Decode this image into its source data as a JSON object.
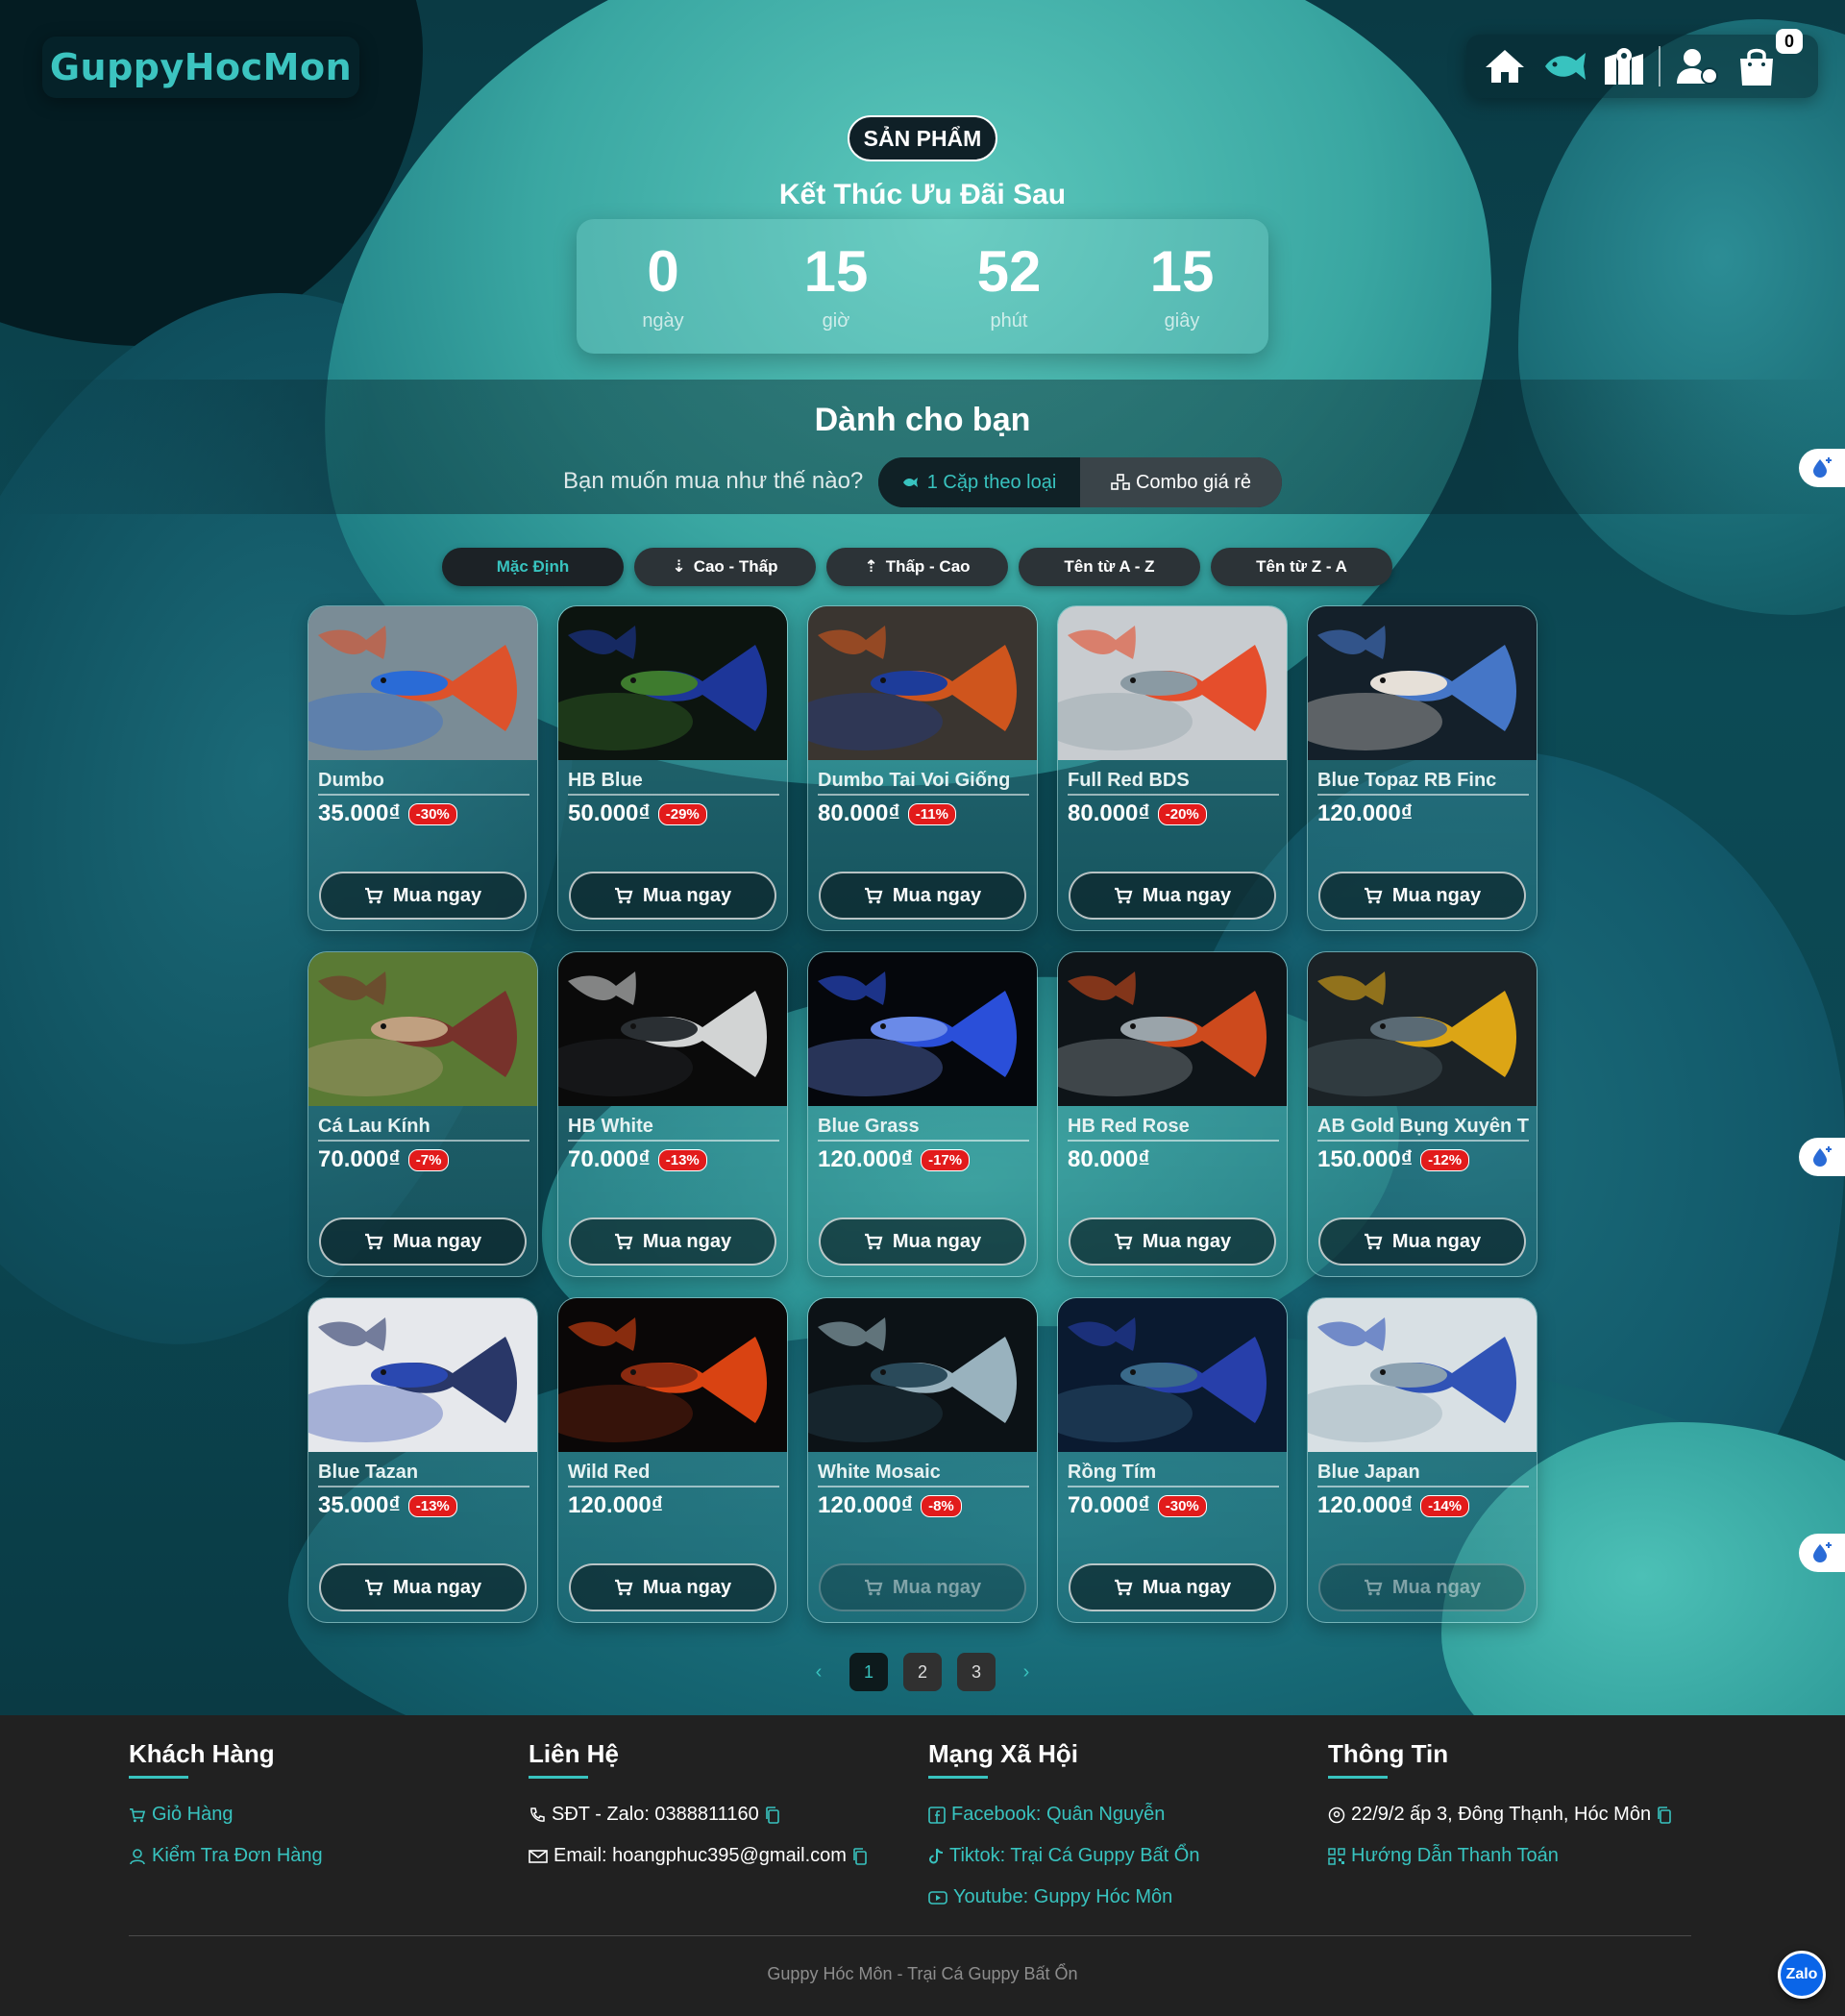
{
  "brand": {
    "logo_text": "GuppyHocMon"
  },
  "nav": {
    "icons": [
      "home-icon",
      "fish-icon",
      "map-icon",
      "user-icon",
      "shopping-bag-icon"
    ],
    "cart_count": "0"
  },
  "section": {
    "pill_title": "SẢN PHẨM",
    "countdown_title": "Kết Thúc Ưu Đãi Sau",
    "countdown": [
      {
        "value": "0",
        "label": "ngày"
      },
      {
        "value": "15",
        "label": "giờ"
      },
      {
        "value": "52",
        "label": "phút"
      },
      {
        "value": "15",
        "label": "giây"
      }
    ]
  },
  "recommend": {
    "title": "Dành cho bạn",
    "question": "Bạn muốn mua như thế nào?",
    "options": [
      "1 Cặp theo loại",
      "Combo giá rẻ"
    ],
    "selected": "1 Cặp theo loại"
  },
  "sort": {
    "options": [
      "Mặc Định",
      "Cao - Thấp",
      "Thấp - Cao",
      "Tên từ A - Z",
      "Tên từ Z - A"
    ],
    "selected": "Mặc Định"
  },
  "buy_label": "Mua ngay",
  "products": [
    {
      "name": "Dumbo",
      "price": "35.000₫",
      "discount": "-30%",
      "palette": [
        "#7a8c96",
        "#e84b1f",
        "#2a6bd6"
      ],
      "dim": false
    },
    {
      "name": "HB Blue",
      "price": "50.000₫",
      "discount": "-29%",
      "palette": [
        "#0c140f",
        "#1f3aa8",
        "#3e7b2e"
      ],
      "dim": false
    },
    {
      "name": "Dumbo Tai Voi Giống",
      "price": "80.000₫",
      "discount": "-11%",
      "palette": [
        "#3a3530",
        "#e0591c",
        "#1d3c9a"
      ],
      "dim": false
    },
    {
      "name": "Full Red BDS",
      "price": "80.000₫",
      "discount": "-20%",
      "palette": [
        "#c8ccd0",
        "#e8401a",
        "#8a9aa3"
      ],
      "dim": false
    },
    {
      "name": "Blue Topaz RB Finc",
      "price": "120.000₫",
      "discount": "",
      "palette": [
        "#14202a",
        "#4a80d8",
        "#e6e0d8"
      ],
      "dim": false
    },
    {
      "name": "Cá Lau Kính",
      "price": "70.000₫",
      "discount": "-7%",
      "palette": [
        "#5a7a34",
        "#7a2a2a",
        "#c0a080"
      ],
      "dim": false
    },
    {
      "name": "HB White",
      "price": "70.000₫",
      "discount": "-13%",
      "palette": [
        "#0a0a0a",
        "#e8eaea",
        "#2a2f33"
      ],
      "dim": false
    },
    {
      "name": "Blue Grass",
      "price": "120.000₫",
      "discount": "-17%",
      "palette": [
        "#05070c",
        "#2f58f0",
        "#6a8ae8"
      ],
      "dim": false
    },
    {
      "name": "HB Red Rose",
      "price": "80.000₫",
      "discount": "",
      "palette": [
        "#0e1418",
        "#e2501e",
        "#9aa4aa"
      ],
      "dim": false
    },
    {
      "name": "AB Gold Bụng Xuyên Tl",
      "price": "150.000₫",
      "discount": "-12%",
      "palette": [
        "#1b2226",
        "#f2b414",
        "#5a6a74"
      ],
      "dim": false
    },
    {
      "name": "Blue Tazan",
      "price": "35.000₫",
      "discount": "-13%",
      "palette": [
        "#e6e8ec",
        "#14235a",
        "#2a48b0"
      ],
      "dim": false
    },
    {
      "name": "Wild Red",
      "price": "120.000₫",
      "discount": "",
      "palette": [
        "#0a0707",
        "#f04a14",
        "#8a2a10"
      ],
      "dim": false
    },
    {
      "name": "White Mosaic",
      "price": "120.000₫",
      "discount": "-8%",
      "palette": [
        "#0c1216",
        "#a8c4d0",
        "#2a4a5a"
      ],
      "dim": true
    },
    {
      "name": "Rồng Tím",
      "price": "70.000₫",
      "discount": "-30%",
      "palette": [
        "#0a1a30",
        "#2a44b8",
        "#3a6a8a"
      ],
      "dim": false
    },
    {
      "name": "Blue Japan",
      "price": "120.000₫",
      "discount": "-14%",
      "palette": [
        "#d8e0e4",
        "#1e44b0",
        "#8aa0b0"
      ],
      "dim": true
    }
  ],
  "pagination": {
    "pages": [
      "1",
      "2",
      "3"
    ],
    "current": "1",
    "prev": "‹",
    "next": "›"
  },
  "footer": {
    "columns": [
      {
        "title": "Khách Hàng",
        "links": [
          {
            "icon": "cart-icon",
            "text": "Giỏ Hàng",
            "color": "cyan"
          },
          {
            "icon": "user-icon",
            "text": "Kiểm Tra Đơn Hàng",
            "color": "cyan"
          }
        ]
      },
      {
        "title": "Liên Hệ",
        "links": [
          {
            "icon": "phone-icon",
            "text": "SĐT - Zalo: 0388811160",
            "color": "white",
            "copy": true
          },
          {
            "icon": "mail-icon",
            "text": "Email: hoangphuc395@gmail.com",
            "color": "white",
            "copy": true
          }
        ]
      },
      {
        "title": "Mạng Xã Hội",
        "links": [
          {
            "icon": "facebook-icon",
            "text": "Facebook: Quân Nguyễn",
            "color": "cyan"
          },
          {
            "icon": "tiktok-icon",
            "text": "Tiktok: Trại Cá Guppy Bất Ổn",
            "color": "cyan"
          },
          {
            "icon": "youtube-icon",
            "text": "Youtube: Guppy Hóc Môn",
            "color": "cyan"
          }
        ]
      },
      {
        "title": "Thông Tin",
        "links": [
          {
            "icon": "location-icon",
            "text": "22/9/2 ấp 3, Đông Thạnh, Hóc Môn",
            "color": "white",
            "copy": true
          },
          {
            "icon": "qr-icon",
            "text": "Hướng Dẫn Thanh Toán",
            "color": "cyan"
          }
        ]
      }
    ],
    "copyright": "Guppy Hóc Môn - Trại Cá Guppy Bất Ổn",
    "zalo_label": "Zalo"
  }
}
